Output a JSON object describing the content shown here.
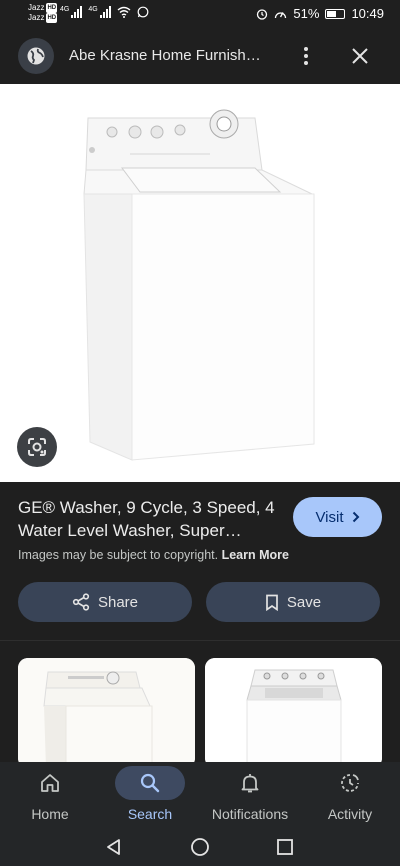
{
  "status_bar": {
    "carrier1": "Jazz",
    "carrier2": "Jazz",
    "hd": "HD",
    "net1": "4G",
    "net2": "4G",
    "battery": "51%",
    "time": "10:49"
  },
  "header": {
    "title": "Abe Krasne Home Furnish…"
  },
  "result": {
    "title": "GE® Washer, 9 Cycle, 3 Speed, 4 Water Level Washer, Super…",
    "visit_label": "Visit",
    "copyright_text": "Images may be subject to copyright.",
    "learn_more": "Learn More",
    "share_label": "Share",
    "save_label": "Save"
  },
  "nav": {
    "items": [
      {
        "label": "Home",
        "icon": "home-icon"
      },
      {
        "label": "Search",
        "icon": "search-icon",
        "active": true
      },
      {
        "label": "Notifications",
        "icon": "bell-icon"
      },
      {
        "label": "Activity",
        "icon": "activity-icon"
      }
    ]
  },
  "colors": {
    "background": "#1f1f1f",
    "accent": "#a8c7fa",
    "button": "#394457",
    "nav_active": "#3e4a61"
  }
}
